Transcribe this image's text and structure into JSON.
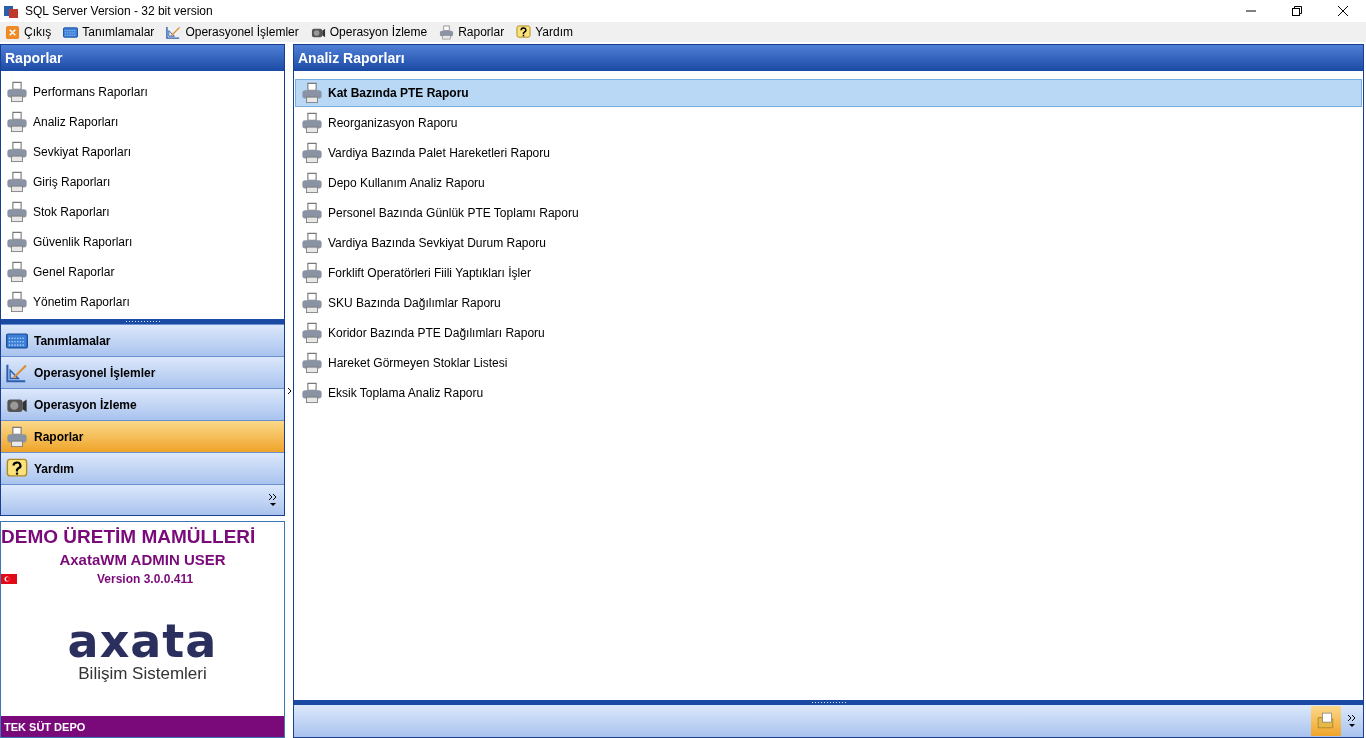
{
  "window": {
    "title": "SQL Server Version - 32 bit version"
  },
  "menu": [
    {
      "label": "Çıkış",
      "kind": "exit"
    },
    {
      "label": "Tanımlamalar",
      "kind": "keyboard"
    },
    {
      "label": "Operasyonel İşlemler",
      "kind": "ruler"
    },
    {
      "label": "Operasyon İzleme",
      "kind": "camera"
    },
    {
      "label": "Raporlar",
      "kind": "printer"
    },
    {
      "label": "Yardım",
      "kind": "help"
    }
  ],
  "left_panel": {
    "title": "Raporlar",
    "items": [
      {
        "label": "Performans Raporları"
      },
      {
        "label": "Analiz Raporları"
      },
      {
        "label": "Sevkiyat Raporları"
      },
      {
        "label": "Giriş Raporları"
      },
      {
        "label": "Stok Raporları"
      },
      {
        "label": "Güvenlik Raporları"
      },
      {
        "label": "Genel Raporlar"
      },
      {
        "label": "Yönetim Raporları"
      }
    ],
    "nav": [
      {
        "label": "Tanımlamalar",
        "kind": "keyboard",
        "selected": false
      },
      {
        "label": "Operasyonel İşlemler",
        "kind": "ruler",
        "selected": false
      },
      {
        "label": "Operasyon İzleme",
        "kind": "camera",
        "selected": false
      },
      {
        "label": "Raporlar",
        "kind": "printer",
        "selected": true
      },
      {
        "label": "Yardım",
        "kind": "help",
        "selected": false
      }
    ]
  },
  "info": {
    "company": "DEMO ÜRETİM MAMÜLLERİ",
    "user": "AxataWM ADMIN USER",
    "version": "Version 3.0.0.411",
    "logo_text": "axata",
    "logo_subtitle": "Bilişim Sistemleri",
    "footer": "TEK SÜT DEPO"
  },
  "right_panel": {
    "title": "Analiz Raporları",
    "reports": [
      {
        "label": "Kat Bazında PTE Raporu",
        "selected": true
      },
      {
        "label": "Reorganizasyon Raporu",
        "selected": false
      },
      {
        "label": "Vardiya Bazında Palet Hareketleri Raporu",
        "selected": false
      },
      {
        "label": "Depo Kullanım Analiz Raporu",
        "selected": false
      },
      {
        "label": "Personel Bazında Günlük PTE Toplamı Raporu",
        "selected": false
      },
      {
        "label": "Vardiya Bazında Sevkiyat Durum Raporu",
        "selected": false
      },
      {
        "label": "Forklift Operatörleri Fiili Yaptıkları İşler",
        "selected": false
      },
      {
        "label": "SKU Bazında Dağılımlar Raporu",
        "selected": false
      },
      {
        "label": "Koridor Bazında PTE Dağılımları Raporu",
        "selected": false
      },
      {
        "label": "Hareket Görmeyen Stoklar Listesi",
        "selected": false
      },
      {
        "label": "Eksik Toplama Analiz Raporu",
        "selected": false
      }
    ],
    "toolbar_button": {
      "selected": true
    }
  }
}
